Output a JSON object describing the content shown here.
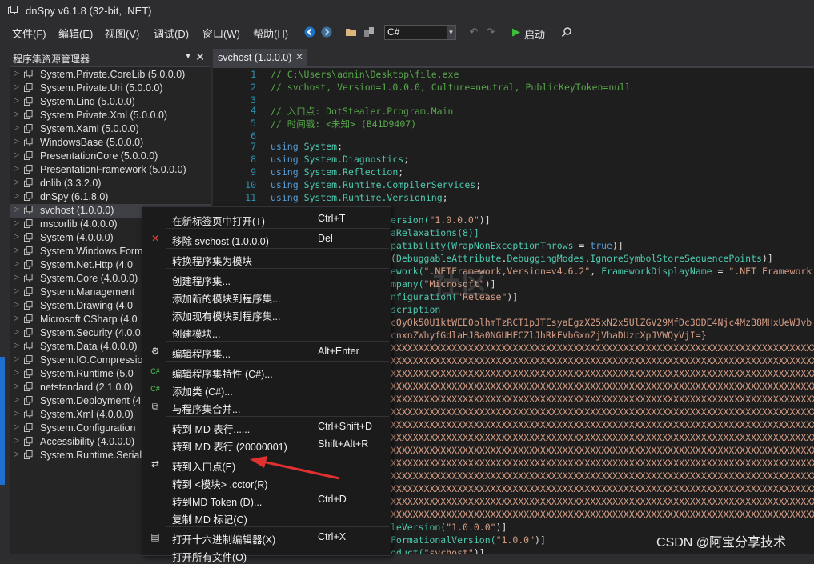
{
  "window": {
    "title": "dnSpy v6.1.8 (32-bit, .NET)"
  },
  "menu": [
    "文件(F)",
    "编辑(E)",
    "视图(V)",
    "调试(D)",
    "窗口(W)",
    "帮助(H)"
  ],
  "toolbar": {
    "language": "C#",
    "run_label": "启动"
  },
  "explorer": {
    "title": "程序集资源管理器",
    "items": [
      "System.Private.CoreLib (5.0.0.0)",
      "System.Private.Uri (5.0.0.0)",
      "System.Linq (5.0.0.0)",
      "System.Private.Xml (5.0.0.0)",
      "System.Xaml (5.0.0.0)",
      "WindowsBase (5.0.0.0)",
      "PresentationCore (5.0.0.0)",
      "PresentationFramework (5.0.0.0)",
      "dnlib (3.3.2.0)",
      "dnSpy (6.1.8.0)",
      "svchost (1.0.0.0)",
      "mscorlib (4.0.0.0)",
      "System (4.0.0.0)",
      "System.Windows.Forms",
      "System.Net.Http (4.0",
      "System.Core (4.0.0.0)",
      "System.Management",
      "System.Drawing (4.0",
      "Microsoft.CSharp (4.0",
      "System.Security (4.0.0.",
      "System.Data (4.0.0.0)",
      "System.IO.Compressio",
      "System.Runtime (5.0",
      "netstandard (2.1.0.0)",
      "System.Deployment (4",
      "System.Xml (4.0.0.0)",
      "System.Configuration",
      "Accessibility (4.0.0.0)",
      "System.Runtime.Serial"
    ]
  },
  "tab": {
    "label": "svchost (1.0.0.0)"
  },
  "code": {
    "line_numbers": [
      "1",
      "2",
      "3",
      "4",
      "5",
      "6",
      "7",
      "8",
      "9",
      "10",
      "11"
    ],
    "comment1": "// C:\\Users\\admin\\Desktop\\file.exe",
    "comment2": "// svchost, Version=1.0.0.0, Culture=neutral, PublicKeyToken=null",
    "comment4": "// 入口点: DotStealer.Program.Main",
    "comment5": "// 时间戳: <未知> (B41D9407)",
    "using_kw": "using",
    "using7": "System",
    "using8": "System.Diagnostics",
    "using9": "System.Reflection",
    "using10": "System.Runtime.CompilerServices",
    "using11": "System.Runtime.Versioning",
    "r1a": "ersion(",
    "r1b": "\"1.0.0.0\"",
    "r1c": ")]",
    "r2": "aRelaxations(8)]",
    "r3a": "patibility(",
    "r3b": "WrapNonExceptionThrows",
    "r3c": " = ",
    "r3d": "true",
    "r3e": ")]",
    "r4a": "(",
    "r4b": "DebuggableAttribute",
    "r4c": ".",
    "r4d": "DebuggingModes",
    "r4e": ".",
    "r4f": "IgnoreSymbolStoreSequencePoints",
    "r4g": ")]",
    "r5a": "ework(",
    "r5b": "\".NETFramework,Version=v4.6.2\"",
    "r5c": ", ",
    "r5d": "FrameworkDisplayName",
    "r5e": " = ",
    "r5f": "\".NET Framework",
    "r6a": "mpany(",
    "r6b": "\"Microsoft\"",
    "r6c": ")]",
    "r7a": "nfiguration(",
    "r7b": "\"Release\"",
    "r7c": ")]",
    "r8": "scription",
    "r9": "cQyOk50U1ktWEE0blhmTzRCT1pJTEsyaEgzX25xN2x5UlZGV29MfDc3ODE4Njc4MzB8MHxUeWJvb",
    "r10": "cnxnZWhyfGdlaHJ8a0NGUHFCZlJhRkFVbGxnZjVhaDUzcXpJVWQyVjI=}",
    "xline": "XXXXXXXXXXXXXXXXXXXXXXXXXXXXXXXXXXXXXXXXXXXXXXXXXXXXXXXXXXXXXXXXXXXXXXXXXXXXXXXXX",
    "b1a": "leVersion(",
    "b1b": "\"1.0.0.0\"",
    "b1c": ")]",
    "b2a": "FormationalVersion(",
    "b2b": "\"1.0.0\"",
    "b2c": ")]",
    "b3a": "oduct(",
    "b3b": "\"svchost\"",
    "b3c": ")]"
  },
  "context_menu": {
    "items": [
      {
        "label": "在新标签页中打开(T)",
        "shortcut": "Ctrl+T"
      },
      {
        "label": "移除 svchost (1.0.0.0)",
        "shortcut": "Del"
      },
      {
        "label": "转换程序集为模块",
        "shortcut": ""
      },
      {
        "label": "创建程序集...",
        "shortcut": ""
      },
      {
        "label": "添加新的模块到程序集...",
        "shortcut": ""
      },
      {
        "label": "添加现有模块到程序集...",
        "shortcut": ""
      },
      {
        "label": "创建模块...",
        "shortcut": ""
      },
      {
        "label": "编辑程序集...",
        "shortcut": "Alt+Enter"
      },
      {
        "label": "编辑程序集特性 (C#)...",
        "shortcut": ""
      },
      {
        "label": "添加类 (C#)...",
        "shortcut": ""
      },
      {
        "label": "与程序集合并...",
        "shortcut": ""
      },
      {
        "label": "转到 MD 表行......",
        "shortcut": "Ctrl+Shift+D"
      },
      {
        "label": "转到 MD 表行 (20000001)",
        "shortcut": "Shift+Alt+R"
      },
      {
        "label": "转到入口点(E)",
        "shortcut": ""
      },
      {
        "label": "转到 <模块> .cctor(R)",
        "shortcut": ""
      },
      {
        "label": "转到MD Token (D)...",
        "shortcut": "Ctrl+D"
      },
      {
        "label": "复制 MD 标记(C)",
        "shortcut": ""
      },
      {
        "label": "打开十六进制编辑器(X)",
        "shortcut": "Ctrl+X"
      },
      {
        "label": "打开所有文件(O)",
        "shortcut": ""
      }
    ]
  },
  "watermark": "CSDN @阿宝分享技术",
  "watermark_center": "奇安",
  "watermark_center2": "社区",
  "colors": {
    "background": "#2d2d30",
    "editor": "#1e1e1e",
    "comment": "#57a64a",
    "keyword": "#569cd6",
    "type": "#4ec9b0",
    "string": "#d69d85",
    "arrow": "#e03030"
  }
}
